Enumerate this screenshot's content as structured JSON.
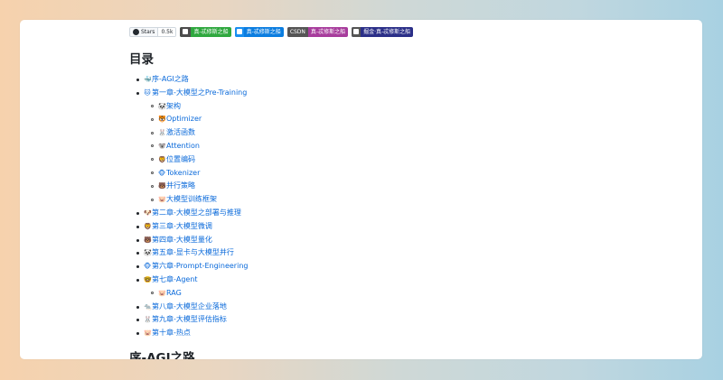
{
  "badges": {
    "stars_label": "Stars",
    "stars_count": "0.5k",
    "wechat": "真-忒修斯之船",
    "zhihu": "真-忒修斯之船",
    "csdn_left": "CSDN",
    "csdn_right": "真-忒修斯之船",
    "juejin": "掘金·真-忒修斯之船"
  },
  "toc_title": "目录",
  "toc": [
    {
      "icon": "🐳",
      "label": "序-AGI之路"
    },
    {
      "icon": "🐱",
      "label": "第一章-大模型之Pre-Training",
      "children": [
        {
          "icon": "🐼",
          "label": "架构"
        },
        {
          "icon": "🐯",
          "label": "Optimizer"
        },
        {
          "icon": "🐰",
          "label": "激活函数"
        },
        {
          "icon": "🐨",
          "label": "Attention"
        },
        {
          "icon": "🦁",
          "label": "位置编码"
        },
        {
          "icon": "🐵",
          "label": "Tokenizer"
        },
        {
          "icon": "🐻",
          "label": "并行策略"
        },
        {
          "icon": "🐷",
          "label": "大模型训练框架"
        }
      ]
    },
    {
      "icon": "🐶",
      "label": "第二章-大模型之部署与推理"
    },
    {
      "icon": "🦁",
      "label": "第三章-大模型微调"
    },
    {
      "icon": "🐻",
      "label": "第四章-大模型量化"
    },
    {
      "icon": "🐼",
      "label": "第五章-显卡与大模型并行"
    },
    {
      "icon": "🐵",
      "label": "第六章-Prompt-Engineering"
    },
    {
      "icon": "🤓",
      "label": "第七章-Agent",
      "children": [
        {
          "icon": "🐷",
          "label": "RAG"
        }
      ]
    },
    {
      "icon": "🐀",
      "label": "第八章-大模型企业落地"
    },
    {
      "icon": "🐰",
      "label": "第九章-大模型评估指标"
    },
    {
      "icon": "🐷",
      "label": "第十章-热点"
    }
  ],
  "section_title": "序-AGI之路"
}
